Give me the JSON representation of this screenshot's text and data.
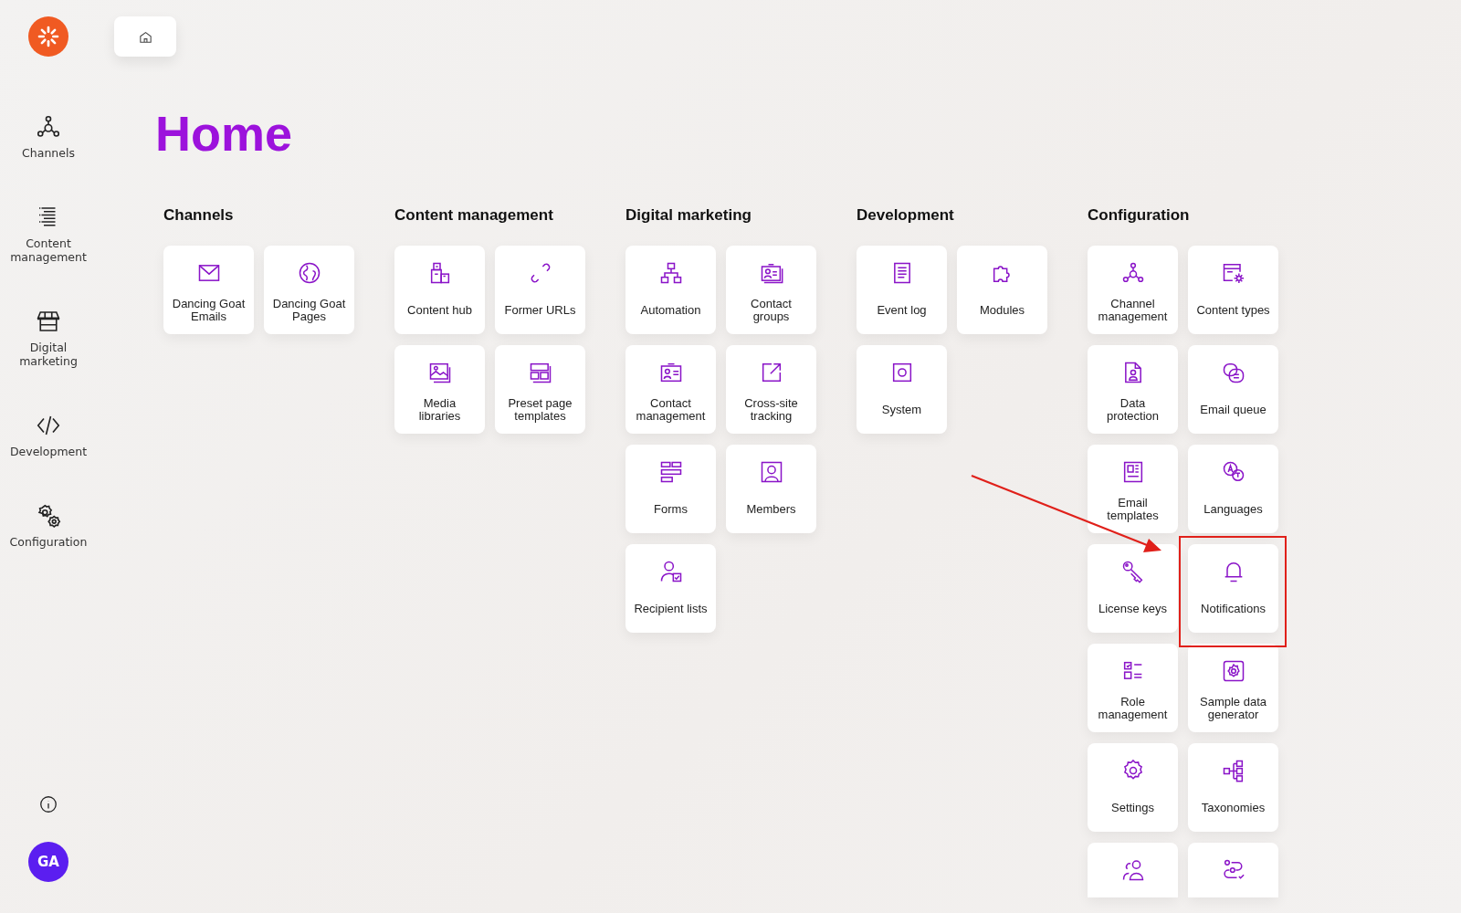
{
  "sidebar": {
    "items": [
      {
        "label": "Channels"
      },
      {
        "label": "Content management"
      },
      {
        "label": "Digital marketing"
      },
      {
        "label": "Development"
      },
      {
        "label": "Configuration"
      }
    ],
    "avatar": {
      "initials": "GA"
    }
  },
  "page": {
    "title": "Home"
  },
  "sections": [
    {
      "heading": "Channels",
      "tiles": [
        {
          "kind": "full",
          "label": "Dancing Goat Emails"
        },
        {
          "kind": "full",
          "label": "Dancing Goat Pages"
        }
      ]
    },
    {
      "heading": "Content management",
      "tiles": [
        {
          "kind": "full",
          "label": "Content hub"
        },
        {
          "kind": "full",
          "label": "Former URLs"
        },
        {
          "kind": "full",
          "label": "Media libraries"
        },
        {
          "kind": "full",
          "label": "Preset page templates"
        }
      ]
    },
    {
      "heading": "Digital marketing",
      "tiles": [
        {
          "kind": "full",
          "label": "Automation"
        },
        {
          "kind": "full",
          "label": "Contact groups"
        },
        {
          "kind": "full",
          "label": "Contact management"
        },
        {
          "kind": "full",
          "label": "Cross-site tracking"
        },
        {
          "kind": "full",
          "label": "Forms"
        },
        {
          "kind": "full",
          "label": "Members"
        },
        {
          "kind": "full",
          "label": "Recipient lists"
        }
      ]
    },
    {
      "heading": "Development",
      "tiles": [
        {
          "kind": "full",
          "label": "Event log"
        },
        {
          "kind": "full",
          "label": "Modules"
        },
        {
          "kind": "full",
          "label": "System"
        }
      ]
    },
    {
      "heading": "Configuration",
      "tiles": [
        {
          "kind": "full",
          "label": "Channel management"
        },
        {
          "kind": "full",
          "label": "Content types"
        },
        {
          "kind": "full",
          "label": "Data protection"
        },
        {
          "kind": "full",
          "label": "Email queue"
        },
        {
          "kind": "full",
          "label": "Email templates"
        },
        {
          "kind": "full",
          "label": "Languages"
        },
        {
          "kind": "full",
          "label": "License keys"
        },
        {
          "kind": "full",
          "label": "Notifications"
        },
        {
          "kind": "full",
          "label": "Role management"
        },
        {
          "kind": "full",
          "label": "Sample data generator"
        },
        {
          "kind": "full",
          "label": "Settings"
        },
        {
          "kind": "full",
          "label": "Taxonomies"
        },
        {
          "kind": "cut_off"
        },
        {
          "kind": "cut_off"
        }
      ]
    }
  ],
  "annotation": {
    "arrow": true,
    "highlight_box": true
  }
}
